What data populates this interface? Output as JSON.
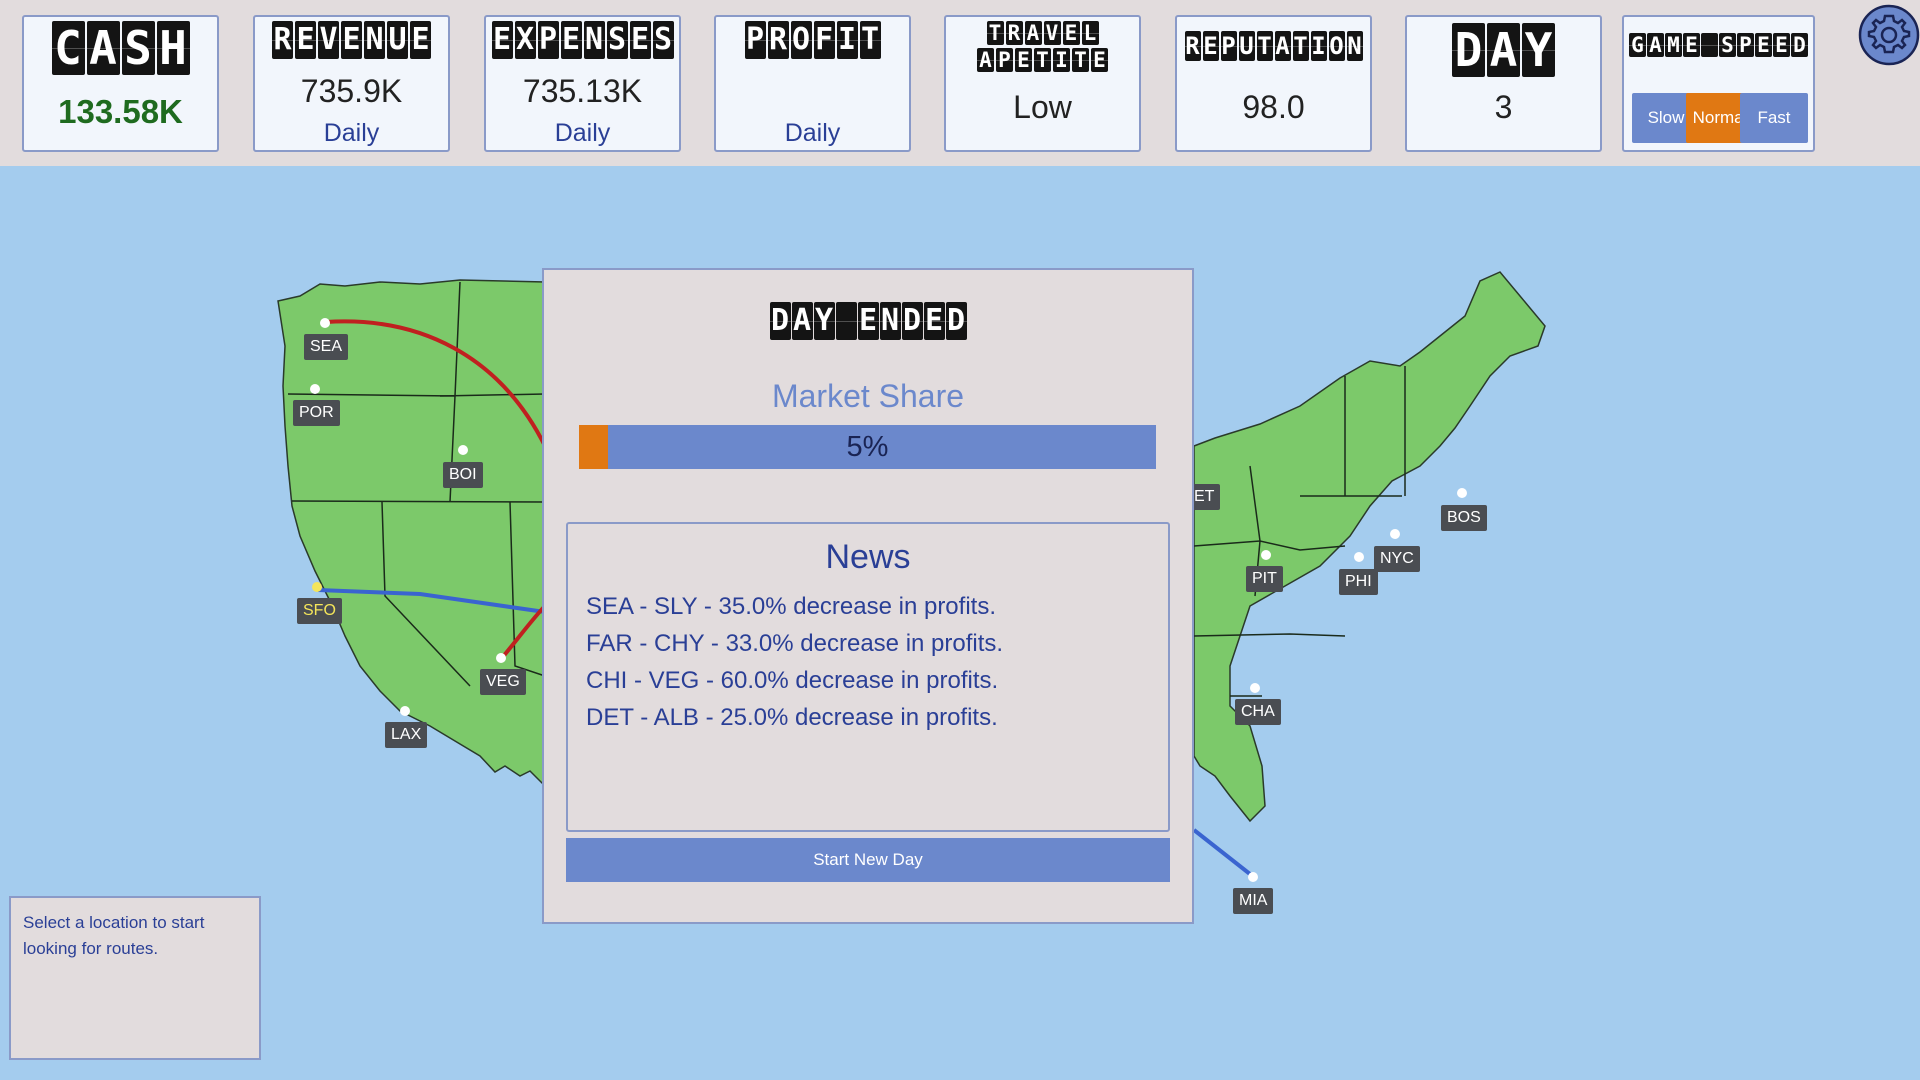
{
  "hud": {
    "cash": {
      "title": "CASH",
      "value": "133.58K"
    },
    "revenue": {
      "title": "REVENUE",
      "value": "735.9K",
      "sub": "Daily"
    },
    "expenses": {
      "title": "EXPENSES",
      "value": "735.13K",
      "sub": "Daily"
    },
    "profit": {
      "title": "PROFIT",
      "value": "",
      "sub": "Daily"
    },
    "travel": {
      "title_line1": "TRAVEL",
      "title_line2": "APETITE",
      "value": "Low"
    },
    "reputation": {
      "title": "REPUTATION",
      "value": "98.0"
    },
    "day": {
      "title": "DAY",
      "value": "3"
    },
    "speed": {
      "title": "GAME SPEED",
      "options": [
        "Slow",
        "Normal",
        "Fast"
      ],
      "selected": "Normal"
    }
  },
  "settings_icon": "gear-icon",
  "map": {
    "cities": [
      {
        "code": "SEA"
      },
      {
        "code": "POR"
      },
      {
        "code": "BOI"
      },
      {
        "code": "SFO",
        "selected": true
      },
      {
        "code": "VEG"
      },
      {
        "code": "LAX"
      },
      {
        "code": "ET"
      },
      {
        "code": "PIT"
      },
      {
        "code": "PHI"
      },
      {
        "code": "NYC"
      },
      {
        "code": "BOS"
      },
      {
        "code": "CHA"
      },
      {
        "code": "MIA"
      }
    ]
  },
  "info_box": {
    "text": "Select a location to start looking for routes."
  },
  "modal": {
    "title": "DAY ENDED",
    "market_share_label": "Market Share",
    "market_share_percent": 5,
    "market_share_text": "5%",
    "news_title": "News",
    "news": [
      "SEA - SLY - 35.0% decrease in profits.",
      "FAR - CHY - 33.0% decrease in profits.",
      "CHI - VEG - 60.0% decrease in profits.",
      "DET - ALB - 25.0% decrease in profits."
    ],
    "start_button": "Start New Day"
  },
  "colors": {
    "ocean": "#a4ccee",
    "land": "#7cc96a",
    "accent_blue": "#6b88cc",
    "accent_orange": "#e07813",
    "route_red": "#c02020",
    "route_blue": "#3a64d0"
  }
}
